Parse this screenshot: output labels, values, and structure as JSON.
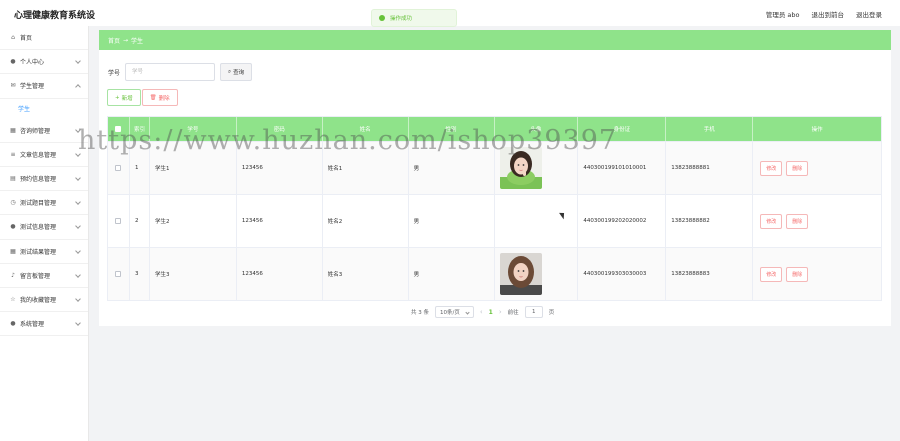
{
  "app": {
    "title": "心理健康教育系统设",
    "admin_label": "管理员 abo",
    "exit_frontend": "退出到前台",
    "logout": "退出登录"
  },
  "toast": {
    "message": "操作成功"
  },
  "sidebar": {
    "items": [
      {
        "label": "首页",
        "icon": "home-icon"
      },
      {
        "label": "个人中心",
        "icon": "user-icon"
      },
      {
        "label": "学生管理",
        "icon": "mail-icon",
        "open": true
      },
      {
        "label": "咨询师管理",
        "icon": "grid-icon"
      },
      {
        "label": "文章信息管理",
        "icon": "list-icon"
      },
      {
        "label": "预约信息管理",
        "icon": "calendar-icon"
      },
      {
        "label": "测试题目管理",
        "icon": "clock-icon"
      },
      {
        "label": "测试信息管理",
        "icon": "user-icon"
      },
      {
        "label": "测试结果管理",
        "icon": "grid-icon"
      },
      {
        "label": "留言板管理",
        "icon": "mic-icon"
      },
      {
        "label": "我的收藏管理",
        "icon": "star-icon"
      },
      {
        "label": "系统管理",
        "icon": "user-icon"
      }
    ],
    "sub_item": "学生"
  },
  "breadcrumb": {
    "home": "首页",
    "separator": "→",
    "current": "学生"
  },
  "search": {
    "label": "学号",
    "placeholder": "学号",
    "button": "查询"
  },
  "actions": {
    "add": "新增",
    "delete": "删除"
  },
  "table": {
    "headers": [
      "索引",
      "学号",
      "密码",
      "姓名",
      "性别",
      "头像",
      "身份证",
      "手机",
      "操作"
    ],
    "rows": [
      {
        "index": "1",
        "student_id": "学生1",
        "password": "123456",
        "name": "姓名1",
        "gender": "男",
        "has_avatar": true,
        "id_card": "440300199101010001",
        "phone": "13823888881"
      },
      {
        "index": "2",
        "student_id": "学生2",
        "password": "123456",
        "name": "姓名2",
        "gender": "男",
        "has_avatar": false,
        "id_card": "440300199202020002",
        "phone": "13823888882"
      },
      {
        "index": "3",
        "student_id": "学生3",
        "password": "123456",
        "name": "姓名3",
        "gender": "男",
        "has_avatar": true,
        "id_card": "440300199303030003",
        "phone": "13823888883"
      }
    ],
    "edit_label": "修改",
    "delete_label": "删除"
  },
  "pagination": {
    "total": "共 3 条",
    "page_size": "10条/页",
    "prev": "‹",
    "current_page": "1",
    "next": "›",
    "goto_label": "前往",
    "goto_value": "1",
    "page_suffix": "页"
  },
  "watermark": "https://www.huzhan.com/ishop39397",
  "colors": {
    "accent": "#8fe38a",
    "danger": "#f56c6c",
    "success": "#67c23a"
  }
}
